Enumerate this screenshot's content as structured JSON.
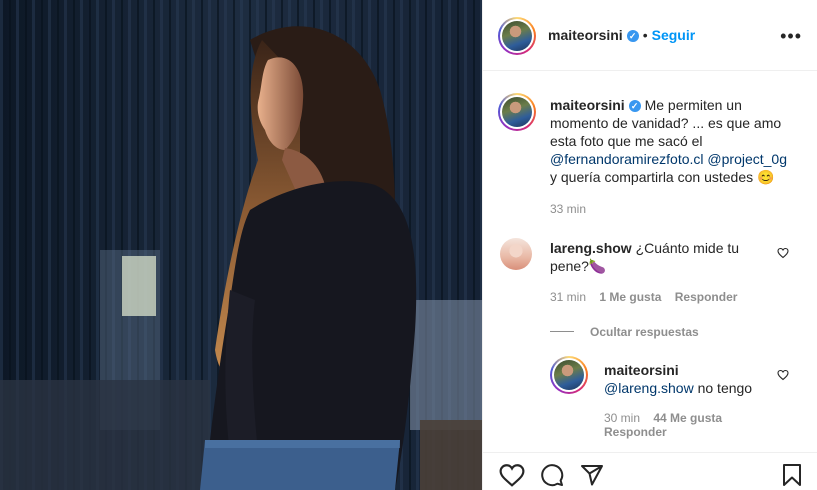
{
  "post": {
    "username": "maiteorsini",
    "verified_icon": "verified-badge-icon",
    "separator": "•",
    "follow_label": "Seguir",
    "more_icon": "more-options-icon",
    "more_glyph": "•••"
  },
  "caption": {
    "username": "maiteorsini",
    "text_before": "Me permiten un momento de vanidad? ... es que amo esta foto que me sacó el ",
    "mention_1": "@fernandoramirezfoto.cl",
    "mention_2": "@project_0g",
    "text_after": " y quería compartirla con ustedes 😊",
    "time": "33 min"
  },
  "comments": [
    {
      "username": "lareng.show",
      "text": "¿Cuánto mide tu pene?🍆",
      "time": "31 min",
      "likes": "1 Me gusta",
      "reply_label": "Responder"
    }
  ],
  "replies_toggle": {
    "label": "Ocultar respuestas"
  },
  "reply": {
    "username": "maiteorsini",
    "mention": "@lareng.show",
    "text": " no tengo",
    "time": "30 min",
    "likes": "44 Me gusta",
    "reply_label": "Responder"
  },
  "actions": {
    "like_icon": "heart-icon",
    "comment_icon": "comment-icon",
    "share_icon": "share-icon",
    "save_icon": "bookmark-icon"
  },
  "colors": {
    "follow_blue": "#0095f6",
    "mention_blue": "#00376b",
    "meta_gray": "#8e8e8e",
    "verified_blue": "#3897f0"
  }
}
